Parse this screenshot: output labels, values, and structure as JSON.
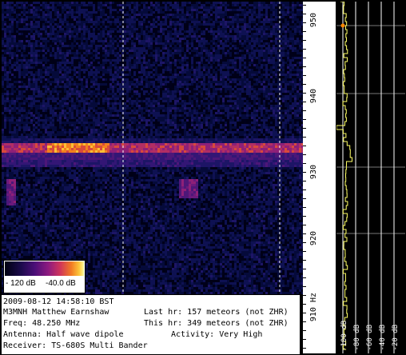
{
  "colors": {
    "background": "#000000",
    "panel": "#ffffff",
    "level_trace": "#ffff66",
    "grid": "#ffffff",
    "marker_dashed": "#ffffff"
  },
  "colorbar": {
    "min_label": "- 120 dB",
    "max_label": "-40.0 dB"
  },
  "frequency_scale": {
    "labels": [
      "950",
      "940",
      "930",
      "920",
      "910 Hz"
    ]
  },
  "level_panel": {
    "labels": [
      "-100 dB",
      "-80 dB",
      "-60 dB",
      "-40 dB",
      "-20 dB"
    ]
  },
  "info": {
    "timestamp": "2009-08-12 14:58:10 BST",
    "observer": "M3MNH Matthew Earnshaw",
    "freq": "Freq: 48.250 MHz",
    "antenna": "Antenna: Half wave dipole",
    "receiver": "Receiver: TS-680S Multi Bander",
    "last_hr": "Last hr: 157 meteors (not ZHR)",
    "this_hr": "This hr: 349 meteors (not ZHR)",
    "activity": "Activity: Very High"
  }
}
